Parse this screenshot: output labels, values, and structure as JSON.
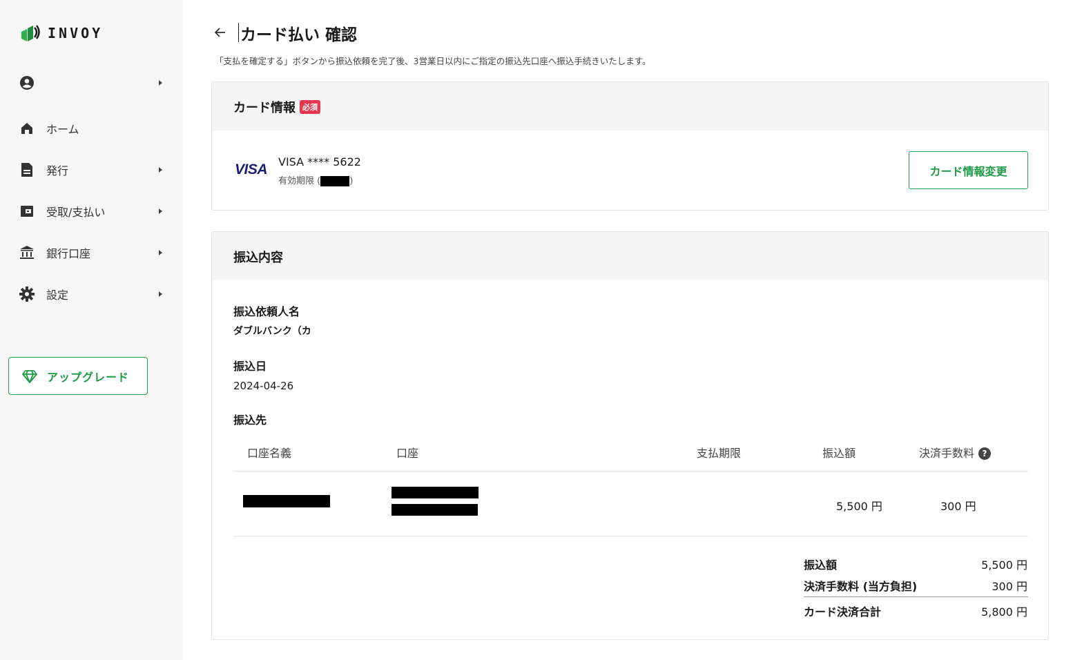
{
  "brand": {
    "name": "INVOY"
  },
  "sidebar": {
    "items": [
      {
        "label": "",
        "icon": "account-circle-icon"
      },
      {
        "label": "ホーム",
        "icon": "home-icon"
      },
      {
        "label": "発行",
        "icon": "document-icon"
      },
      {
        "label": "受取/支払い",
        "icon": "wallet-icon"
      },
      {
        "label": "銀行口座",
        "icon": "bank-icon"
      },
      {
        "label": "設定",
        "icon": "gear-icon"
      }
    ],
    "upgrade_label": "アップグレード"
  },
  "page": {
    "title": "カード払い 確認",
    "description": "「支払を確定する」ボタンから振込依頼を完了後、3営業日以内にご指定の振込先口座へ振込手続きいたします。"
  },
  "card_info": {
    "heading": "カード情報",
    "required_badge": "必須",
    "brand_logo": "VISA",
    "number": "VISA **** 5622",
    "expiry_prefix": "有効期限 (",
    "expiry_suffix": ")",
    "change_button": "カード情報変更"
  },
  "transfer": {
    "heading": "振込内容",
    "requester_label": "振込依頼人名",
    "requester_value": "ダブルバンク（カ",
    "date_label": "振込日",
    "date_value": "2024-04-26",
    "destination_label": "振込先",
    "columns": [
      "口座名義",
      "口座",
      "支払期限",
      "振込額",
      "決済手数料"
    ],
    "row": {
      "holder": "",
      "account": "",
      "due": "",
      "amount": "5,500 円",
      "fee": "300 円"
    },
    "summary": [
      {
        "label": "振込額",
        "value": "5,500 円"
      },
      {
        "label": "決済手数料 (当方負担)",
        "value": "300 円"
      },
      {
        "label": "カード決済合計",
        "value": "5,800 円"
      }
    ]
  },
  "colors": {
    "accent": "#1aa34a",
    "badge": "#e8384f",
    "visa": "#1a1f71"
  }
}
